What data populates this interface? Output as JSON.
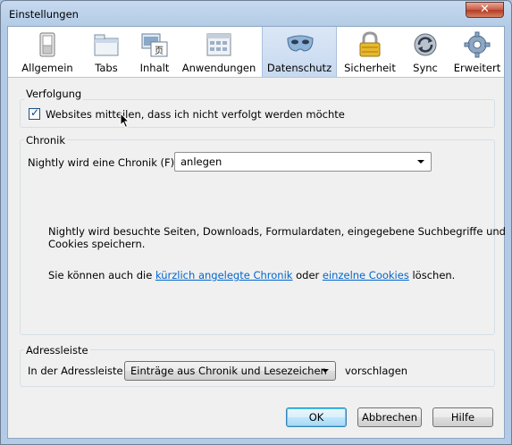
{
  "window": {
    "title": "Einstellungen",
    "close_glyph": "✕"
  },
  "toolbar": {
    "panes": [
      {
        "label": "Allgemein",
        "icon": "switch-icon"
      },
      {
        "label": "Tabs",
        "icon": "tabs-icon"
      },
      {
        "label": "Inhalt",
        "icon": "content-icon"
      },
      {
        "label": "Anwendungen",
        "icon": "applications-icon"
      },
      {
        "label": "Datenschutz",
        "icon": "mask-icon",
        "active": true
      },
      {
        "label": "Sicherheit",
        "icon": "lock-icon"
      },
      {
        "label": "Sync",
        "icon": "sync-icon"
      },
      {
        "label": "Erweitert",
        "icon": "gear-icon"
      }
    ]
  },
  "tracking": {
    "title": "Verfolgung",
    "checkbox_label": "Websites mitteilen, dass ich nicht verfolgt werden möchte",
    "checked": true
  },
  "history": {
    "title": "Chronik",
    "select_label": "Nightly wird eine Chronik (F):",
    "select_value": "anlegen",
    "description": "Nightly wird besuchte Seiten, Downloads, Formulardaten, eingegebene Suchbegriffe und",
    "description_2": "Cookies speichern.",
    "clear_prefix": "Sie können auch die",
    "clear_link_1": "kürzlich angelegte Chronik",
    "clear_middle": "oder",
    "clear_link_2": "einzelne Cookies",
    "clear_suffix": "löschen."
  },
  "location_bar": {
    "title": "Adressleiste",
    "prefix": "In der Adressleiste",
    "select_value": "Einträge aus Chronik und Lesezeichen",
    "suffix": "vorschlagen"
  },
  "buttons": {
    "ok": "OK",
    "cancel": "Abbrechen",
    "help": "Hilfe"
  }
}
